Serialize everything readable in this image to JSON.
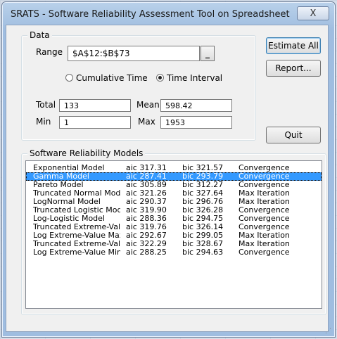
{
  "window": {
    "title": "SRATS - Software Reliability Assessment Tool on Spreadsheet",
    "close_symbol": "X"
  },
  "data_group": {
    "label": "Data",
    "range_label": "Range",
    "range_value": "$A$12:$B$73",
    "range_button": "_",
    "radio_cumulative": "Cumulative Time",
    "radio_interval": "Time Interval",
    "selected_radio": "interval",
    "total_label": "Total",
    "total_value": "133",
    "min_label": "Min",
    "min_value": "1",
    "mean_label": "Mean",
    "mean_value": "598.42",
    "max_label": "Max",
    "max_value": "1953"
  },
  "buttons": {
    "estimate_all": "Estimate All",
    "report": "Report...",
    "quit": "Quit"
  },
  "models_group": {
    "label": "Software Reliability Models",
    "selected_index": 1,
    "rows": [
      {
        "name": "Exponential Model",
        "aic": "aic 317.31",
        "bic": "bic 321.57",
        "status": "Convergence"
      },
      {
        "name": "Gamma Model",
        "aic": "aic 287.41",
        "bic": "bic 293.79",
        "status": "Convergence"
      },
      {
        "name": "Pareto Model",
        "aic": "aic 305.89",
        "bic": "bic 312.27",
        "status": "Convergence"
      },
      {
        "name": "Truncated Normal Mode",
        "aic": "aic 321.26",
        "bic": "bic 327.64",
        "status": "Max Iteration"
      },
      {
        "name": "LogNormal Model",
        "aic": "aic 290.37",
        "bic": "bic 296.76",
        "status": "Max Iteration"
      },
      {
        "name": "Truncated Logistic Mode",
        "aic": "aic 319.90",
        "bic": "bic 326.28",
        "status": "Convergence"
      },
      {
        "name": "Log-Logistic Model",
        "aic": "aic 288.36",
        "bic": "bic 294.75",
        "status": "Convergence"
      },
      {
        "name": "Truncated Extreme-Valu",
        "aic": "aic 319.76",
        "bic": "bic 326.14",
        "status": "Convergence"
      },
      {
        "name": "Log Extreme-Value Max",
        "aic": "aic 292.67",
        "bic": "bic 299.05",
        "status": "Max Iteration"
      },
      {
        "name": "Truncated Extreme-Valu",
        "aic": "aic 322.29",
        "bic": "bic 328.67",
        "status": "Max Iteration"
      },
      {
        "name": "Log Extreme-Value Mini",
        "aic": "aic 288.25",
        "bic": "bic 294.63",
        "status": "Convergence"
      }
    ]
  }
}
